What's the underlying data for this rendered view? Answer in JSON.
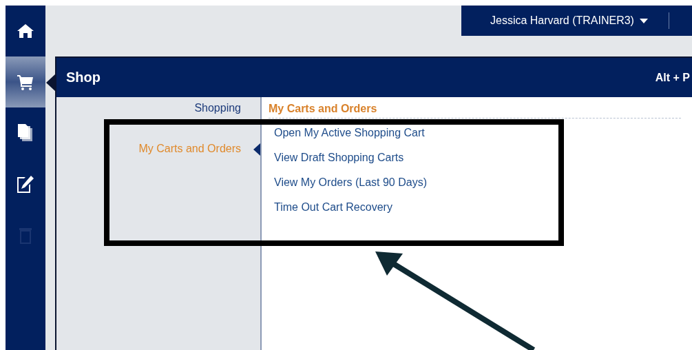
{
  "sidebar": {
    "items": [
      {
        "kind": "home",
        "selected": false,
        "disabled": false
      },
      {
        "kind": "cart",
        "selected": true,
        "disabled": false
      },
      {
        "kind": "documents",
        "selected": false,
        "disabled": false
      },
      {
        "kind": "edit",
        "selected": false,
        "disabled": false
      },
      {
        "kind": "trash",
        "selected": false,
        "disabled": true
      }
    ]
  },
  "user_menu": {
    "label": "Jessica Harvard (TRAINER3)"
  },
  "panel": {
    "title": "Shop",
    "shortcut": "Alt + P",
    "nav": [
      {
        "label": "Shopping",
        "selected": false
      },
      {
        "label": "My Carts and Orders",
        "selected": true
      }
    ],
    "section": {
      "title": "My Carts and Orders",
      "links": [
        "Open My Active Shopping Cart",
        "View Draft Shopping Carts",
        "View My Orders (Last 90 Days)",
        "Time Out Cart Recovery"
      ]
    }
  }
}
